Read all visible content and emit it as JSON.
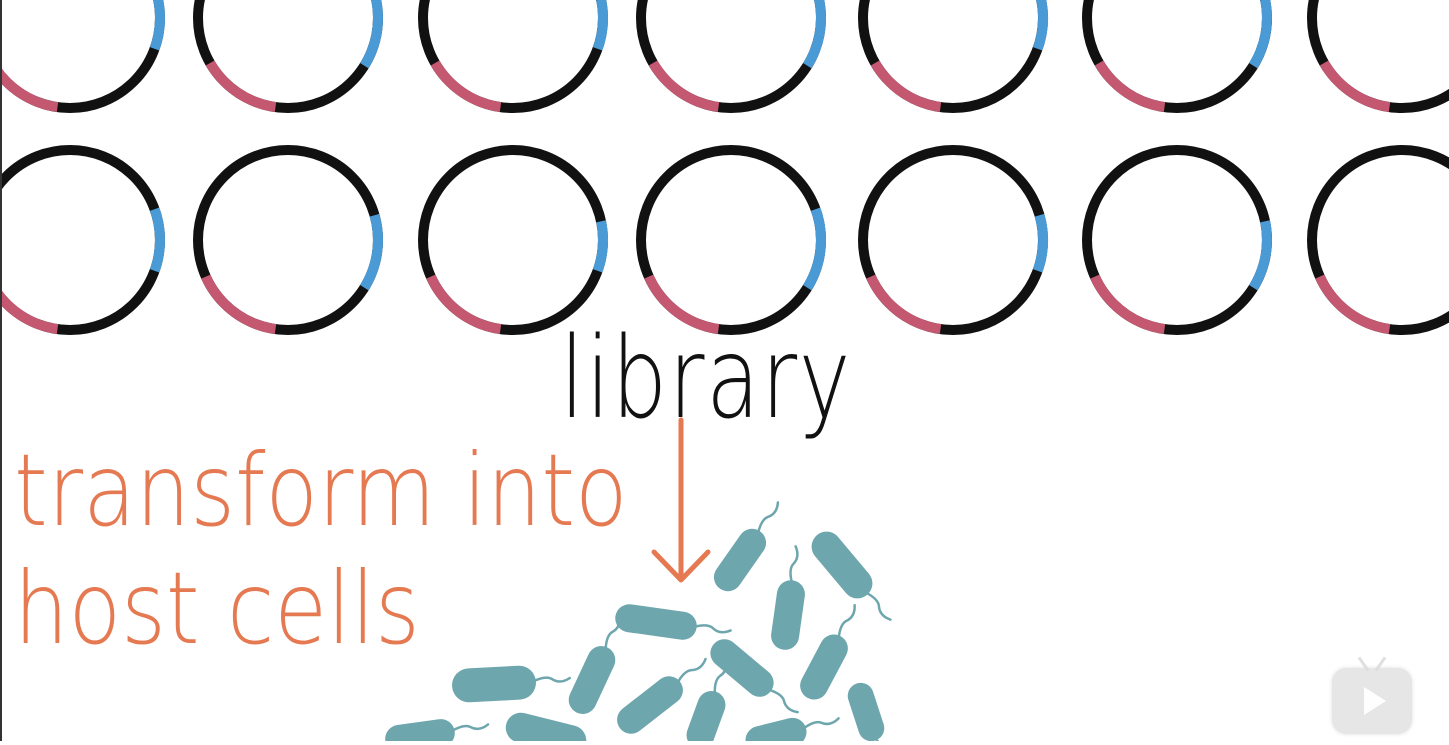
{
  "labels": {
    "library": "library",
    "transform_line1": "transform into",
    "transform_line2": "host cells"
  },
  "colors": {
    "plasmid_backbone": "#111111",
    "insert_red": "#c45870",
    "marker_blue": "#4a9ad6",
    "cell_teal": "#6ea6ad",
    "annotation_orange": "#e57a52",
    "label_black": "#111111"
  },
  "icons": {
    "plasmid": "plasmid-ring-icon",
    "bacterium": "bacterium-cell-icon",
    "arrow": "down-arrow-icon",
    "player": "tv-play-icon"
  }
}
